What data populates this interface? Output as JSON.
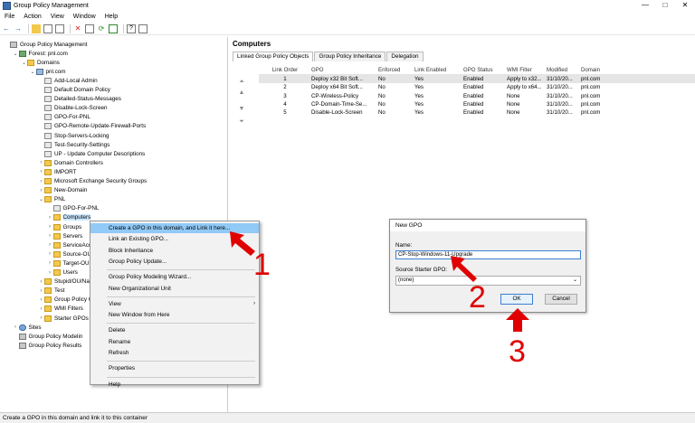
{
  "window": {
    "title": "Group Policy Management",
    "controls": [
      "—",
      "□",
      "✕"
    ]
  },
  "menu": [
    "File",
    "Action",
    "View",
    "Window",
    "Help"
  ],
  "tree": [
    {
      "label": "Group Policy Management",
      "depth": 0,
      "exp": "",
      "icon": "root"
    },
    {
      "label": "Forest: pnl.com",
      "depth": 1,
      "exp": "⌄",
      "icon": "forest"
    },
    {
      "label": "Domains",
      "depth": 2,
      "exp": "⌄",
      "icon": "folder"
    },
    {
      "label": "pnl.com",
      "depth": 3,
      "exp": "⌄",
      "icon": "dom"
    },
    {
      "label": "Add-Local Admin",
      "depth": 4,
      "exp": "",
      "icon": "gpo"
    },
    {
      "label": "Default Domain Policy",
      "depth": 4,
      "exp": "",
      "icon": "gpo"
    },
    {
      "label": "Detailed-Status-Messages",
      "depth": 4,
      "exp": "",
      "icon": "gpo"
    },
    {
      "label": "Disable-Lock-Screen",
      "depth": 4,
      "exp": "",
      "icon": "gpo"
    },
    {
      "label": "GPO-For-PNL",
      "depth": 4,
      "exp": "",
      "icon": "gpo"
    },
    {
      "label": "GPO-Remote-Update-Firewall-Ports",
      "depth": 4,
      "exp": "",
      "icon": "gpo"
    },
    {
      "label": "Stop-Servers-Locking",
      "depth": 4,
      "exp": "",
      "icon": "gpo"
    },
    {
      "label": "Test-Security-Settings",
      "depth": 4,
      "exp": "",
      "icon": "gpo"
    },
    {
      "label": "UP - Update Computer Descriptions",
      "depth": 4,
      "exp": "",
      "icon": "gpo"
    },
    {
      "label": "Domain Controllers",
      "depth": 4,
      "exp": "›",
      "icon": "folder"
    },
    {
      "label": "IMPORT",
      "depth": 4,
      "exp": "›",
      "icon": "folder"
    },
    {
      "label": "Microsoft Exchange Security Groups",
      "depth": 4,
      "exp": "›",
      "icon": "folder"
    },
    {
      "label": "New-Domain",
      "depth": 4,
      "exp": "›",
      "icon": "folder"
    },
    {
      "label": "PNL",
      "depth": 4,
      "exp": "⌄",
      "icon": "folder"
    },
    {
      "label": "GPO-For-PNL",
      "depth": 5,
      "exp": "",
      "icon": "gpo"
    },
    {
      "label": "Computers",
      "depth": 5,
      "exp": "›",
      "icon": "folder",
      "selected": true
    },
    {
      "label": "Groups",
      "depth": 5,
      "exp": "›",
      "icon": "folder"
    },
    {
      "label": "Servers",
      "depth": 5,
      "exp": "›",
      "icon": "folder"
    },
    {
      "label": "ServiceAcc",
      "depth": 5,
      "exp": "›",
      "icon": "folder"
    },
    {
      "label": "Source-OU",
      "depth": 5,
      "exp": "›",
      "icon": "folder"
    },
    {
      "label": "Target-OU",
      "depth": 5,
      "exp": "›",
      "icon": "folder"
    },
    {
      "label": "Users",
      "depth": 5,
      "exp": "›",
      "icon": "folder"
    },
    {
      "label": "Stupid/OU/Na",
      "depth": 4,
      "exp": "›",
      "icon": "folder"
    },
    {
      "label": "Test",
      "depth": 4,
      "exp": "›",
      "icon": "folder"
    },
    {
      "label": "Group Policy O",
      "depth": 4,
      "exp": "›",
      "icon": "folder"
    },
    {
      "label": "WMI Filters",
      "depth": 4,
      "exp": "›",
      "icon": "folder"
    },
    {
      "label": "Starter GPOs",
      "depth": 4,
      "exp": "›",
      "icon": "folder"
    },
    {
      "label": "Sites",
      "depth": 1,
      "exp": "›",
      "icon": "sites"
    },
    {
      "label": "Group Policy Modelin",
      "depth": 1,
      "exp": "",
      "icon": "root"
    },
    {
      "label": "Group Policy Results",
      "depth": 1,
      "exp": "",
      "icon": "root"
    }
  ],
  "right": {
    "header": "Computers",
    "tabs": [
      "Linked Group Policy Objects",
      "Group Policy Inheritance",
      "Delegation"
    ],
    "columns": [
      "Link Order",
      "GPO",
      "Enforced",
      "Link Enabled",
      "GPO Status",
      "WMI Filter",
      "Modified",
      "Domain"
    ],
    "rows": [
      [
        "1",
        "Deploy x32 Bit Soft...",
        "No",
        "Yes",
        "Enabled",
        "Apply to x32...",
        "31/10/20...",
        "pnl.com"
      ],
      [
        "2",
        "Deploy x64 Bit Soft...",
        "No",
        "Yes",
        "Enabled",
        "Apply to x64...",
        "31/10/20...",
        "pnl.com"
      ],
      [
        "3",
        "CP-Wireless-Policy",
        "No",
        "Yes",
        "Enabled",
        "None",
        "31/10/20...",
        "pnl.com"
      ],
      [
        "4",
        "CP-Domain-Time-Se...",
        "No",
        "Yes",
        "Enabled",
        "None",
        "31/10/20...",
        "pnl.com"
      ],
      [
        "5",
        "Disable-Lock-Screen",
        "No",
        "Yes",
        "Enabled",
        "None",
        "31/10/20...",
        "pnl.com"
      ]
    ]
  },
  "context_menu": {
    "items": [
      {
        "label": "Create a GPO in this domain, and Link it here...",
        "highlight": true
      },
      {
        "label": "Link an Existing GPO..."
      },
      {
        "label": "Block Inheritance"
      },
      {
        "label": "Group Policy Update..."
      },
      {
        "sep": true
      },
      {
        "label": "Group Policy Modeling Wizard..."
      },
      {
        "label": "New Organizational Unit"
      },
      {
        "sep": true
      },
      {
        "label": "View",
        "sub": true
      },
      {
        "label": "New Window from Here"
      },
      {
        "sep": true
      },
      {
        "label": "Delete"
      },
      {
        "label": "Rename"
      },
      {
        "label": "Refresh"
      },
      {
        "sep": true
      },
      {
        "label": "Properties"
      },
      {
        "sep": true
      },
      {
        "label": "Help"
      }
    ]
  },
  "dialog": {
    "title": "New GPO",
    "name_label": "Name:",
    "name_value": "CP-Stop-Windows-11-Upgrade",
    "starter_label": "Source Starter GPO:",
    "starter_value": "(none)",
    "ok": "OK",
    "cancel": "Cancel"
  },
  "annotations": [
    "1",
    "2",
    "3"
  ],
  "status": "Create a GPO in this domain and link it to this container",
  "colors": {
    "highlight": "#91c9f7",
    "annotation": "#e00000",
    "selection": "#cce8ff"
  }
}
